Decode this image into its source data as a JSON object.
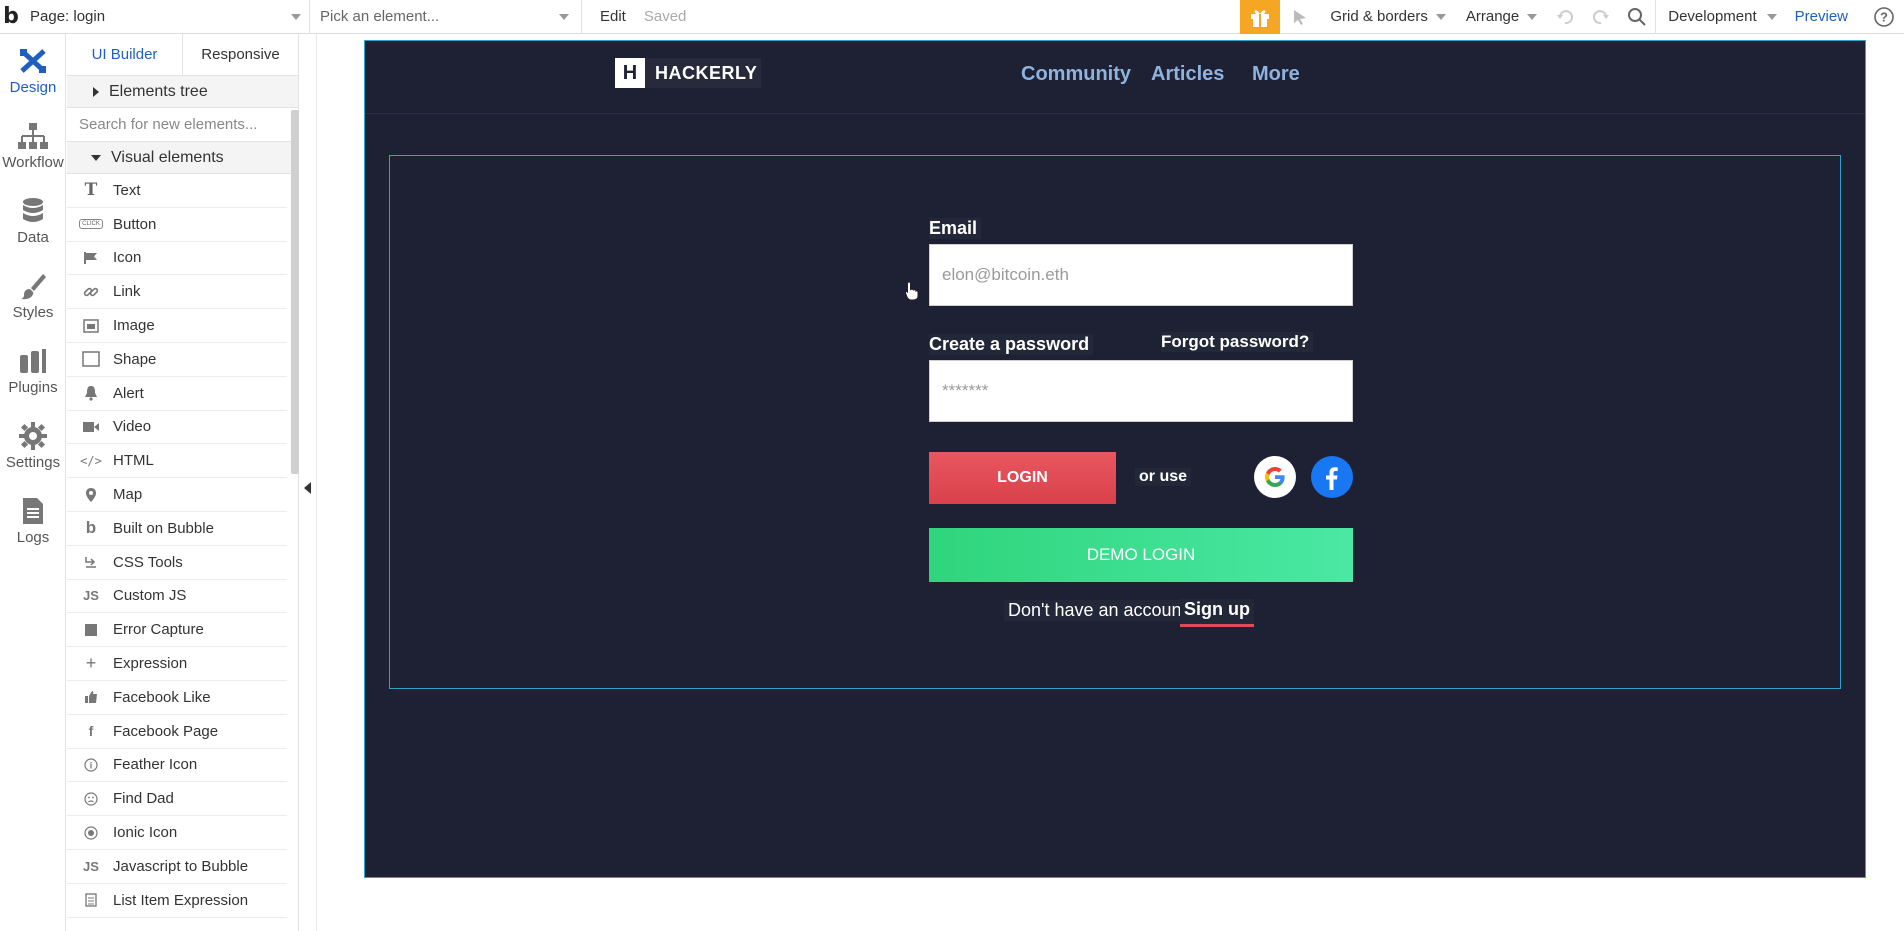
{
  "topbar": {
    "page_label": "Page: login",
    "element_placeholder": "Pick an element...",
    "edit_label": "Edit",
    "saved_label": "Saved",
    "grid_label": "Grid & borders",
    "arrange_label": "Arrange",
    "env_label": "Development",
    "preview_label": "Preview"
  },
  "rail": {
    "items": [
      {
        "label": "Design",
        "icon": "design-icon"
      },
      {
        "label": "Workflow",
        "icon": "workflow-icon"
      },
      {
        "label": "Data",
        "icon": "database-icon"
      },
      {
        "label": "Styles",
        "icon": "brush-icon"
      },
      {
        "label": "Plugins",
        "icon": "plugin-icon"
      },
      {
        "label": "Settings",
        "icon": "gear-icon"
      },
      {
        "label": "Logs",
        "icon": "logs-icon"
      }
    ]
  },
  "panel": {
    "tabs": [
      "UI Builder",
      "Responsive"
    ],
    "tree_label": "Elements tree",
    "search_placeholder": "Search for new elements...",
    "visual_label": "Visual elements",
    "elements": [
      {
        "label": "Text",
        "icon": "T"
      },
      {
        "label": "Button",
        "icon": "CLICK"
      },
      {
        "label": "Icon",
        "icon": "flag"
      },
      {
        "label": "Link",
        "icon": "link"
      },
      {
        "label": "Image",
        "icon": "img"
      },
      {
        "label": "Shape",
        "icon": "sq"
      },
      {
        "label": "Alert",
        "icon": "bell"
      },
      {
        "label": "Video",
        "icon": "vid"
      },
      {
        "label": "HTML",
        "icon": "</>"
      },
      {
        "label": "Map",
        "icon": "pin"
      },
      {
        "label": "Built on Bubble",
        "icon": "b"
      },
      {
        "label": "CSS Tools",
        "icon": "css"
      },
      {
        "label": "Custom JS",
        "icon": "JS"
      },
      {
        "label": "Error Capture",
        "icon": "sqf"
      },
      {
        "label": "Expression",
        "icon": "+"
      },
      {
        "label": "Facebook Like",
        "icon": "thumb"
      },
      {
        "label": "Facebook Page",
        "icon": "f"
      },
      {
        "label": "Feather Icon",
        "icon": "i"
      },
      {
        "label": "Find Dad",
        "icon": "face"
      },
      {
        "label": "Ionic Icon",
        "icon": "dot"
      },
      {
        "label": "Javascript to Bubble",
        "icon": "JS"
      },
      {
        "label": "List Item Expression",
        "icon": "list"
      }
    ]
  },
  "app": {
    "brand_letter": "H",
    "brand_name": "HACKERLY",
    "nav": [
      "Community",
      "Articles",
      "More"
    ],
    "email_label": "Email",
    "email_placeholder": "elon@bitcoin.eth",
    "password_label": "Create a password",
    "forgot_label": "Forgot password?",
    "password_placeholder": "*******",
    "login_label": "LOGIN",
    "or_use_label": "or use",
    "demo_label": "DEMO LOGIN",
    "no_account_label": "Don't have an account?",
    "signup_label": "Sign up"
  },
  "colors": {
    "page_bg": "#1d2133",
    "accent_blue": "#1f5fbf",
    "login_red": "#e04b55",
    "demo_green": "#3ddc8e",
    "selection_border": "#2fa3c7"
  }
}
